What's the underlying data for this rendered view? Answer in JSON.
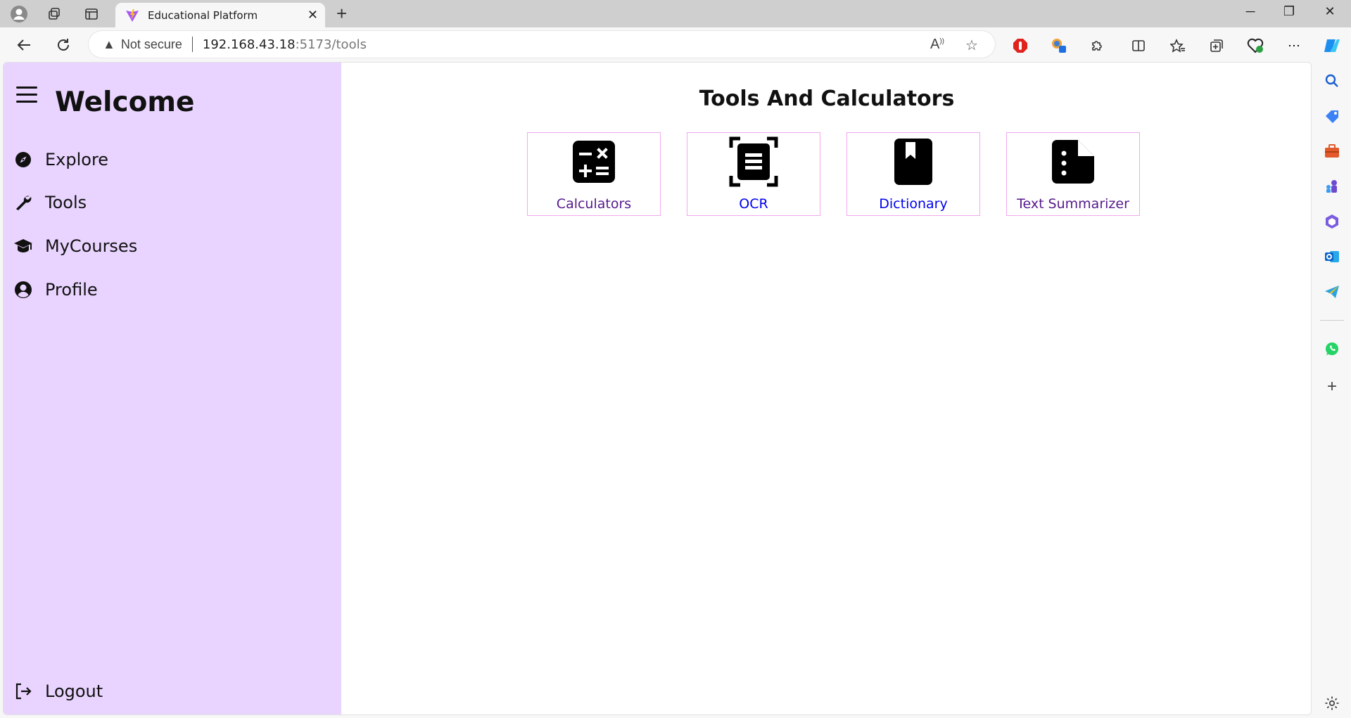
{
  "browser": {
    "tab_title": "Educational Platform",
    "address": {
      "security_label": "Not secure",
      "host": "192.168.43.18",
      "path": ":5173/tools"
    }
  },
  "sidebar": {
    "heading": "Welcome",
    "items": [
      {
        "label": "Explore",
        "icon": "compass-icon"
      },
      {
        "label": "Tools",
        "icon": "wrench-icon"
      },
      {
        "label": "MyCourses",
        "icon": "graduation-cap-icon"
      },
      {
        "label": "Profile",
        "icon": "user-circle-icon"
      }
    ],
    "logout_label": "Logout",
    "background_color": "#e9d4ff"
  },
  "main": {
    "title": "Tools And Calculators",
    "cards": [
      {
        "label": "Calculators",
        "icon": "calculator-icon",
        "link_state": "visited"
      },
      {
        "label": "OCR",
        "icon": "ocr-scan-icon",
        "link_state": "unvisited"
      },
      {
        "label": "Dictionary",
        "icon": "book-icon",
        "link_state": "unvisited"
      },
      {
        "label": "Text Summarizer",
        "icon": "file-lines-icon",
        "link_state": "visited"
      }
    ],
    "card_border_color": "#f1a9ef"
  }
}
